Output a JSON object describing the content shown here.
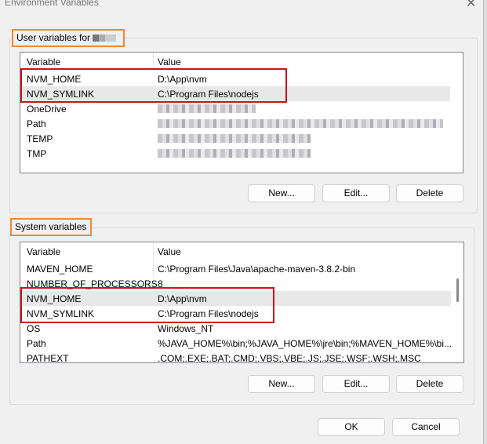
{
  "window": {
    "title": "Environment Variables",
    "close_icon": "close-icon"
  },
  "user": {
    "label": "User variables for",
    "headers": {
      "variable": "Variable",
      "value": "Value"
    },
    "rows": [
      {
        "name": "NVM_HOME",
        "value": "D:\\App\\nvm"
      },
      {
        "name": "NVM_SYMLINK",
        "value": "C:\\Program Files\\nodejs"
      },
      {
        "name": "OneDrive",
        "value": null
      },
      {
        "name": "Path",
        "value": null
      },
      {
        "name": "TEMP",
        "value": null
      },
      {
        "name": "TMP",
        "value": null
      }
    ],
    "buttons": {
      "new": "New...",
      "edit": "Edit...",
      "delete": "Delete"
    }
  },
  "system": {
    "label": "System variables",
    "headers": {
      "variable": "Variable",
      "value": "Value"
    },
    "rows": [
      {
        "name": "MAVEN_HOME",
        "value": "C:\\Program Files\\Java\\apache-maven-3.8.2-bin"
      },
      {
        "name": "NUMBER_OF_PROCESSORS",
        "value": "8"
      },
      {
        "name": "NVM_HOME",
        "value": "D:\\App\\nvm"
      },
      {
        "name": "NVM_SYMLINK",
        "value": "C:\\Program Files\\nodejs"
      },
      {
        "name": "OS",
        "value": "Windows_NT"
      },
      {
        "name": "Path",
        "value": "%JAVA_HOME%\\bin;%JAVA_HOME%\\jre\\bin;%MAVEN_HOME%\\bi..."
      },
      {
        "name": "PATHEXT",
        "value": ".COM;.EXE;.BAT;.CMD;.VBS;.VBE;.JS;.JSE;.WSF;.WSH;.MSC"
      }
    ],
    "buttons": {
      "new": "New...",
      "edit": "Edit...",
      "delete": "Delete"
    }
  },
  "footer": {
    "ok": "OK",
    "cancel": "Cancel"
  },
  "colors": {
    "highlight_red": "#d0121b",
    "highlight_orange": "#f08a2c"
  }
}
